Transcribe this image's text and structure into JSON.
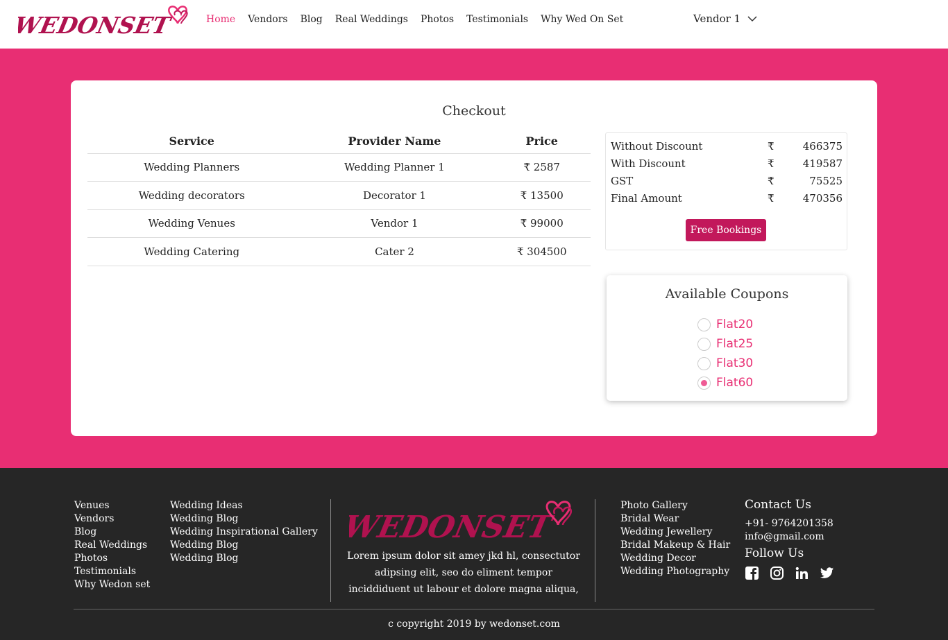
{
  "brand": {
    "name": "WEDONSET"
  },
  "nav": {
    "items": [
      {
        "label": "Home"
      },
      {
        "label": "Vendors"
      },
      {
        "label": "Blog"
      },
      {
        "label": "Real Weddings"
      },
      {
        "label": "Photos"
      },
      {
        "label": "Testimonials"
      },
      {
        "label": "Why Wed On Set"
      }
    ],
    "user": "Vendor 1"
  },
  "checkout": {
    "title": "Checkout",
    "columns": [
      "Service",
      "Provider Name",
      "Price"
    ],
    "rows": [
      [
        "Wedding Planners",
        "Wedding Planner 1",
        "₹ 2587"
      ],
      [
        "Wedding decorators",
        "Decorator 1",
        "₹ 13500"
      ],
      [
        "Wedding Venues",
        "Vendor 1",
        "₹ 99000"
      ],
      [
        "Wedding Catering",
        "Cater 2",
        "₹ 304500"
      ]
    ]
  },
  "summary": {
    "currency": "₹",
    "rows": [
      {
        "label": "Without Discount",
        "value": "466375"
      },
      {
        "label": "With Discount",
        "value": "419587"
      },
      {
        "label": "GST",
        "value": "75525"
      },
      {
        "label": "Final Amount",
        "value": "470356"
      }
    ],
    "button": "Free Bookings"
  },
  "coupons": {
    "title": "Available Coupons",
    "items": [
      {
        "label": "Flat20",
        "checked": false
      },
      {
        "label": "Flat25",
        "checked": false
      },
      {
        "label": "Flat30",
        "checked": false
      },
      {
        "label": "Flat60",
        "checked": true
      }
    ]
  },
  "footer": {
    "col1": [
      "Venues",
      "Vendors",
      "Blog",
      "Real Weddings",
      "Photos",
      "Testimonials",
      "Why Wedon set"
    ],
    "col2": [
      "Wedding Ideas",
      "Wedding Blog",
      "Wedding Inspirational Gallery",
      "Wedding Blog",
      "Wedding Blog"
    ],
    "about": "Lorem ipsum dolor sit amey jkd hl, consectutor adipsing elit, seo do eliment tempor inciddiduent ut labour et dolore magna aliqua,",
    "col3": [
      "Photo Gallery",
      "Bridal Wear",
      "Wedding Jewellery",
      "Bridal Makeup & Hair",
      "Wedding Decor",
      "Wedding Photography"
    ],
    "contact_title": "Contact Us",
    "phone": "+91- 9764201358",
    "email": "info@gmail.com",
    "follow_title": "Follow Us",
    "socials": [
      "facebook-icon",
      "instagram-icon",
      "linkedin-icon",
      "twitter-icon"
    ],
    "copyright": "c copyright 2019 by wedonset.com"
  },
  "colors": {
    "accent": "#e82e73",
    "button": "#c2185b",
    "footer": "#262626"
  }
}
